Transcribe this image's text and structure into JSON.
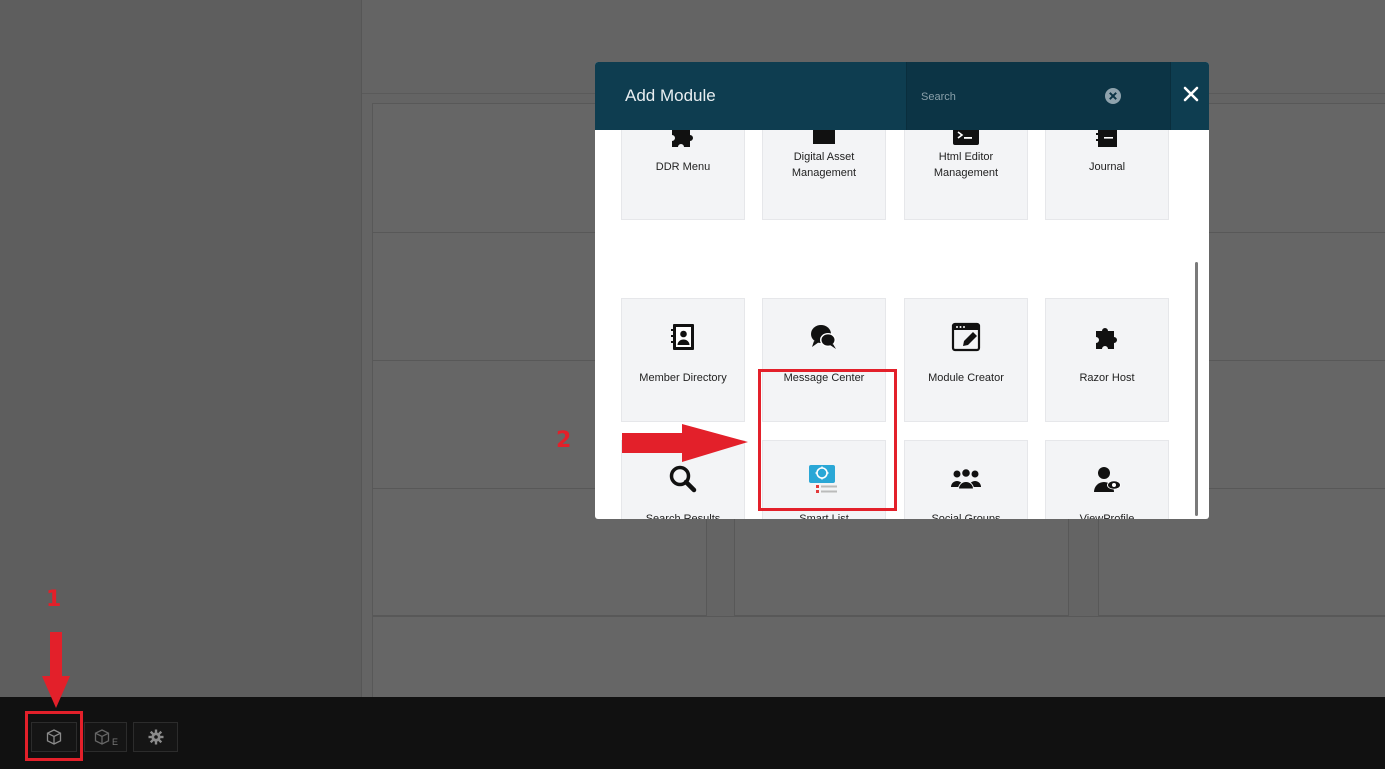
{
  "modal": {
    "title": "Add Module",
    "search_placeholder": "Search",
    "search_value": ""
  },
  "modules": [
    {
      "label": "DDR Menu",
      "icon": "puzzle-piece-icon"
    },
    {
      "label": "Digital Asset Management",
      "icon": "folder-icon"
    },
    {
      "label": "Html Editor Management",
      "icon": "terminal-icon"
    },
    {
      "label": "Journal",
      "icon": "journal-icon"
    },
    {
      "label": "Member Directory",
      "icon": "contact-book-icon"
    },
    {
      "label": "Message Center",
      "icon": "chat-bubbles-icon"
    },
    {
      "label": "Module Creator",
      "icon": "edit-window-icon"
    },
    {
      "label": "Razor Host",
      "icon": "puzzle-piece-icon"
    },
    {
      "label": "Search Results",
      "icon": "magnifier-icon"
    },
    {
      "label": "Smart List",
      "icon": "smart-list-icon"
    },
    {
      "label": "Social Groups",
      "icon": "group-users-icon"
    },
    {
      "label": "ViewProfile",
      "icon": "user-view-icon"
    }
  ],
  "annotations": {
    "step1": "1",
    "step2": "2",
    "color": "#e3202a"
  },
  "toolbar": {
    "add_module_icon": "cube-icon",
    "existing_module_icon": "cube-e-icon",
    "existing_sub": "E",
    "settings_icon": "gear-icon"
  },
  "colors": {
    "header": "#0e3d50",
    "tile": "#f3f4f6",
    "toolbar": "#111111"
  }
}
